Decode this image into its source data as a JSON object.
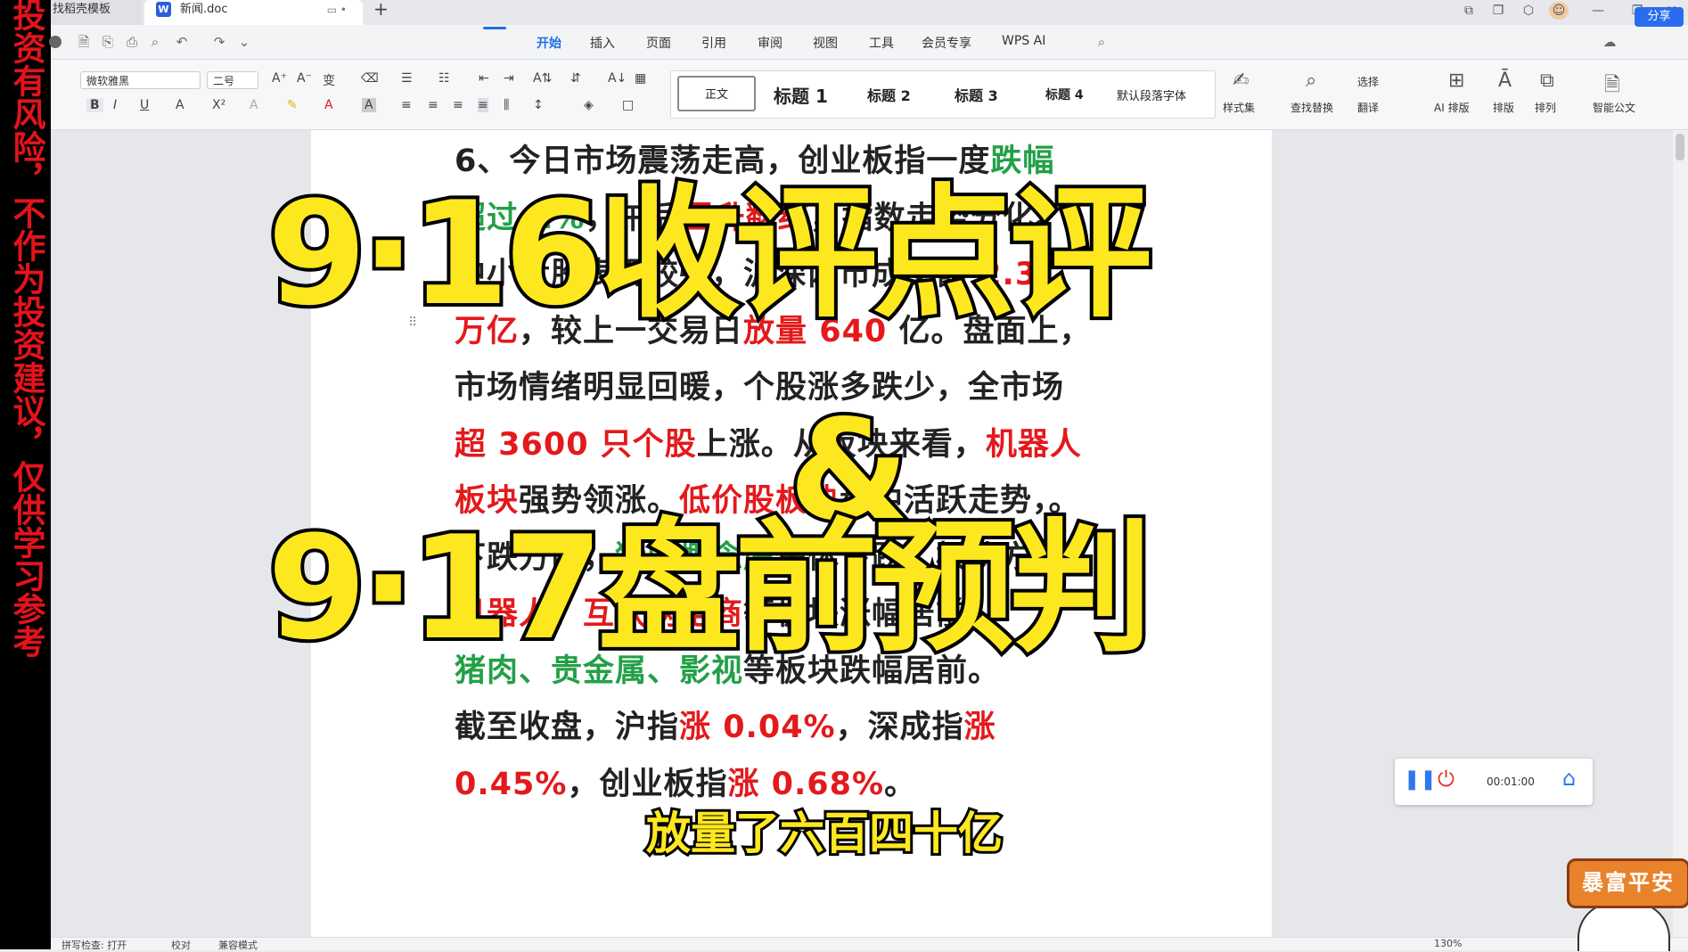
{
  "warning_strip": "投资有风险，不作为投资建议，仅供学习参考",
  "titlebar": {
    "tab_template": "找稻壳模板",
    "tab_doc": "新闻.doc",
    "doc_icon": "W",
    "new_tab": "+"
  },
  "menu": {
    "items": [
      "开始",
      "插入",
      "页面",
      "引用",
      "审阅",
      "视图",
      "工具",
      "会员专享",
      "WPS AI"
    ],
    "share": "分享"
  },
  "ribbon": {
    "font_name": "微软雅黑",
    "font_size": "二号",
    "styles": [
      "正文",
      "标题 1",
      "标题 2",
      "标题 3",
      "标题 4",
      "默认段落字体"
    ],
    "style_set": "样式集",
    "find_replace": "查找替换",
    "select": "选择",
    "translate": "翻译",
    "ai_layout": "AI 排版",
    "layout": "排版",
    "arrange": "排列",
    "smart_doc": "智能公文"
  },
  "document": {
    "lines": [
      [
        {
          "t": "6、今日市场震荡走高，创业板指一度",
          "c": ""
        },
        {
          "t": "跌幅",
          "c": "g"
        }
      ],
      [
        {
          "t": "超过 1%",
          "c": "g"
        },
        {
          "t": "，午后",
          "c": ""
        },
        {
          "t": "回升翻红",
          "c": "r"
        },
        {
          "t": "，指数走势分化。",
          "c": ""
        }
      ],
      [
        {
          "t": "中小盘股表现较强，沪深两市成交额 ",
          "c": ""
        },
        {
          "t": "2.3",
          "c": "r"
        }
      ],
      [
        {
          "t": "万亿",
          "c": "r"
        },
        {
          "t": "，较上一交易日",
          "c": ""
        },
        {
          "t": "放量 640",
          "c": "r"
        },
        {
          "t": " 亿。盘面上，",
          "c": ""
        }
      ],
      [
        {
          "t": "市场情绪明显回暖，个股涨多跌少，全市场",
          "c": ""
        }
      ],
      [
        {
          "t": "超 3600 只个股",
          "c": "r"
        },
        {
          "t": "上涨。从板块来看，",
          "c": ""
        },
        {
          "t": "机器人",
          "c": "r"
        }
      ],
      [
        {
          "t": "板块",
          "c": "r"
        },
        {
          "t": "强势领涨。",
          "c": ""
        },
        {
          "t": "低价股板块",
          "c": "r"
        },
        {
          "t": "盘中活跃走势，。",
          "c": ""
        }
      ],
      [
        {
          "t": "下跌方面，",
          "c": ""
        },
        {
          "t": "猪肉概念股",
          "c": "g"
        },
        {
          "t": "集体下跌。板块方面，",
          "c": ""
        }
      ],
      [
        {
          "t": "机器人、互联网电商",
          "c": "r"
        },
        {
          "t": "等板块涨幅居前，",
          "c": ""
        }
      ],
      [
        {
          "t": "猪肉、贵金属、影视",
          "c": "g"
        },
        {
          "t": "等板块跌幅居前。",
          "c": ""
        }
      ],
      [
        {
          "t": "截至收盘，沪指",
          "c": ""
        },
        {
          "t": "涨 0.04%",
          "c": "r"
        },
        {
          "t": "，深成指",
          "c": ""
        },
        {
          "t": "涨",
          "c": "r"
        }
      ],
      [
        {
          "t": "0.45%",
          "c": "r"
        },
        {
          "t": "，创业板指",
          "c": ""
        },
        {
          "t": "涨 0.68%",
          "c": "r"
        },
        {
          "t": "。",
          "c": ""
        }
      ]
    ]
  },
  "overlay": {
    "title1": "9·16收评点评",
    "amp": "&",
    "title2": "9·17盘前预判",
    "subtitle": "放量了六百四十亿"
  },
  "recorder": {
    "time": "00:01:00"
  },
  "badge": "暴富平安",
  "status": {
    "spell_check": "拼写检查: 打开",
    "proofread": "校对",
    "compat": "兼容模式",
    "zoom": "130%"
  },
  "colors": {
    "warning_red": "#e3131b",
    "doc_red": "#e3191c",
    "doc_green": "#23a047",
    "title_yellow": "#fde820",
    "accent_blue": "#1f6fe5"
  }
}
